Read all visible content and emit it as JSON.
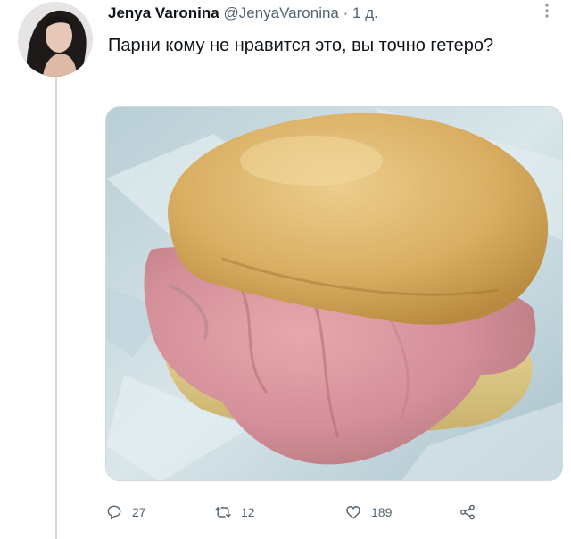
{
  "tweet": {
    "author_name": "Jenya Varonina",
    "handle": "@JenyaVaronina",
    "separator": "·",
    "time": "1 д.",
    "text": "Парни кому не нравится это, вы точно гетеро?",
    "actions": {
      "reply_count": "27",
      "retweet_count": "12",
      "like_count": "189"
    }
  }
}
